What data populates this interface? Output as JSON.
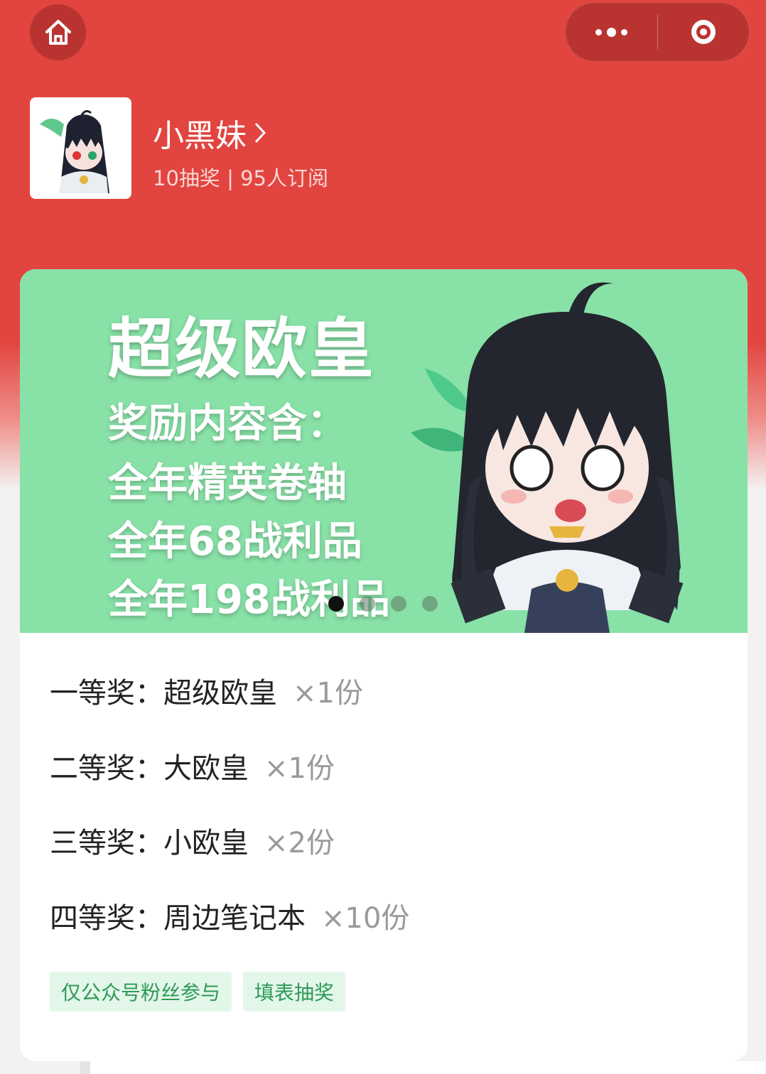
{
  "colors": {
    "header_red": "#e2443f",
    "banner_green": "#88e1a7",
    "tag_text": "#2e9a55",
    "tag_bg": "#e3f6ea"
  },
  "nav": {
    "home_icon": "home-icon",
    "more_icon": "more-dots-icon",
    "close_icon": "target-icon"
  },
  "publisher": {
    "name": "小黑妹",
    "stats": "10抽奖 | 95人订阅"
  },
  "banner": {
    "title": "超级欧皇",
    "lines": [
      "奖励内容含：",
      "全年精英卷轴",
      "全年68战利品",
      "全年198战利品"
    ],
    "slide_count": 4,
    "active_slide": 1
  },
  "prizes": [
    {
      "level": "一等奖：",
      "name": "超级欧皇",
      "qty": "×1份"
    },
    {
      "level": "二等奖：",
      "name": "大欧皇",
      "qty": "×1份"
    },
    {
      "level": "三等奖：",
      "name": "小欧皇",
      "qty": "×2份"
    },
    {
      "level": "四等奖：",
      "name": "周边笔记本",
      "qty": "×10份"
    }
  ],
  "tags": [
    "仅公众号粉丝参与",
    "填表抽奖"
  ]
}
